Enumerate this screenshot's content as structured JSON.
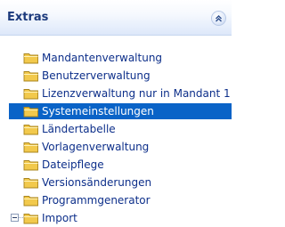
{
  "panel": {
    "title": "Extras",
    "collapse_icon": "chevron-up-icon"
  },
  "colors": {
    "selection": "#0a63c7",
    "link_text": "#0d2f8a",
    "header_text": "#1c3a7c",
    "folder": "#f2c94c"
  },
  "tree": {
    "items": [
      {
        "label": "Mandantenverwaltung",
        "icon": "folder-icon"
      },
      {
        "label": "Benutzerverwaltung",
        "icon": "folder-icon"
      },
      {
        "label": "Lizenzverwaltung nur in Mandant 1",
        "icon": "folder-icon"
      },
      {
        "label": "Systemeinstellungen",
        "icon": "folder-icon",
        "selected": true
      },
      {
        "label": "Ländertabelle",
        "icon": "folder-icon"
      },
      {
        "label": "Vorlagenverwaltung",
        "icon": "folder-icon"
      },
      {
        "label": "Dateipflege",
        "icon": "folder-icon"
      },
      {
        "label": "Versionsänderungen",
        "icon": "folder-icon"
      },
      {
        "label": "Programmgenerator",
        "icon": "folder-icon"
      },
      {
        "label": "Import",
        "icon": "folder-icon",
        "expander": "collapse"
      }
    ]
  }
}
